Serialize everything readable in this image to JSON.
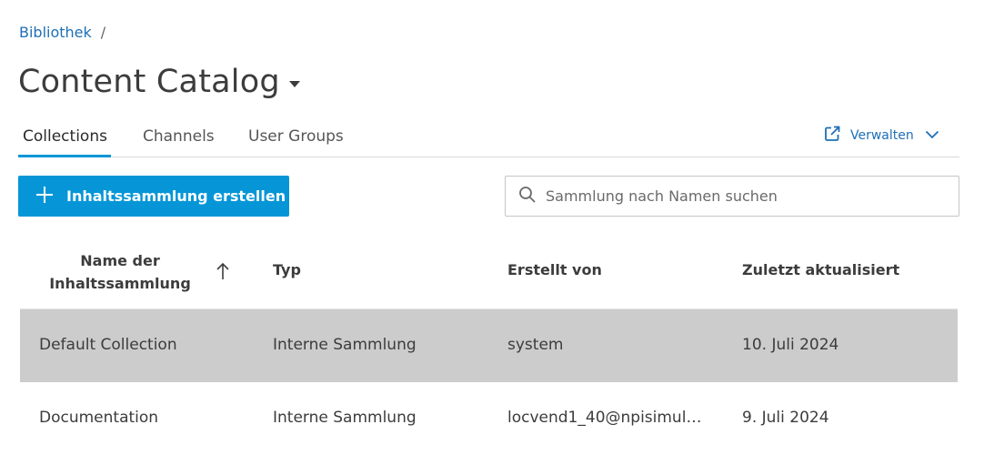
{
  "breadcrumb": {
    "root": "Bibliothek",
    "separator": "/"
  },
  "header": {
    "title": "Content Catalog"
  },
  "tabs": [
    {
      "label": "Collections",
      "active": true
    },
    {
      "label": "Channels",
      "active": false
    },
    {
      "label": "User Groups",
      "active": false
    }
  ],
  "manage": {
    "label": "Verwalten",
    "icon": "external-link-icon"
  },
  "toolbar": {
    "create_label": "Inhaltssammlung erstellen",
    "search_placeholder": "Sammlung nach Namen suchen"
  },
  "table": {
    "columns": [
      "Name der Inhaltssammlung",
      "Typ",
      "Erstellt von",
      "Zuletzt aktualisiert"
    ],
    "column_name_line1": "Name der",
    "column_name_line2": "Inhaltssammlung",
    "sort_direction": "ascending",
    "rows": [
      {
        "name": "Default Collection",
        "type": "Interne Sammlung",
        "creator": "system",
        "updated": "10. Juli 2024",
        "selected": true
      },
      {
        "name": "Documentation",
        "type": "Interne Sammlung",
        "creator": "locvend1_40@npisimula…",
        "updated": "9. Juli 2024",
        "selected": false
      }
    ]
  },
  "colors": {
    "accent": "#0696d7",
    "link": "#1f6fb5",
    "selected_row": "#cccccc"
  }
}
